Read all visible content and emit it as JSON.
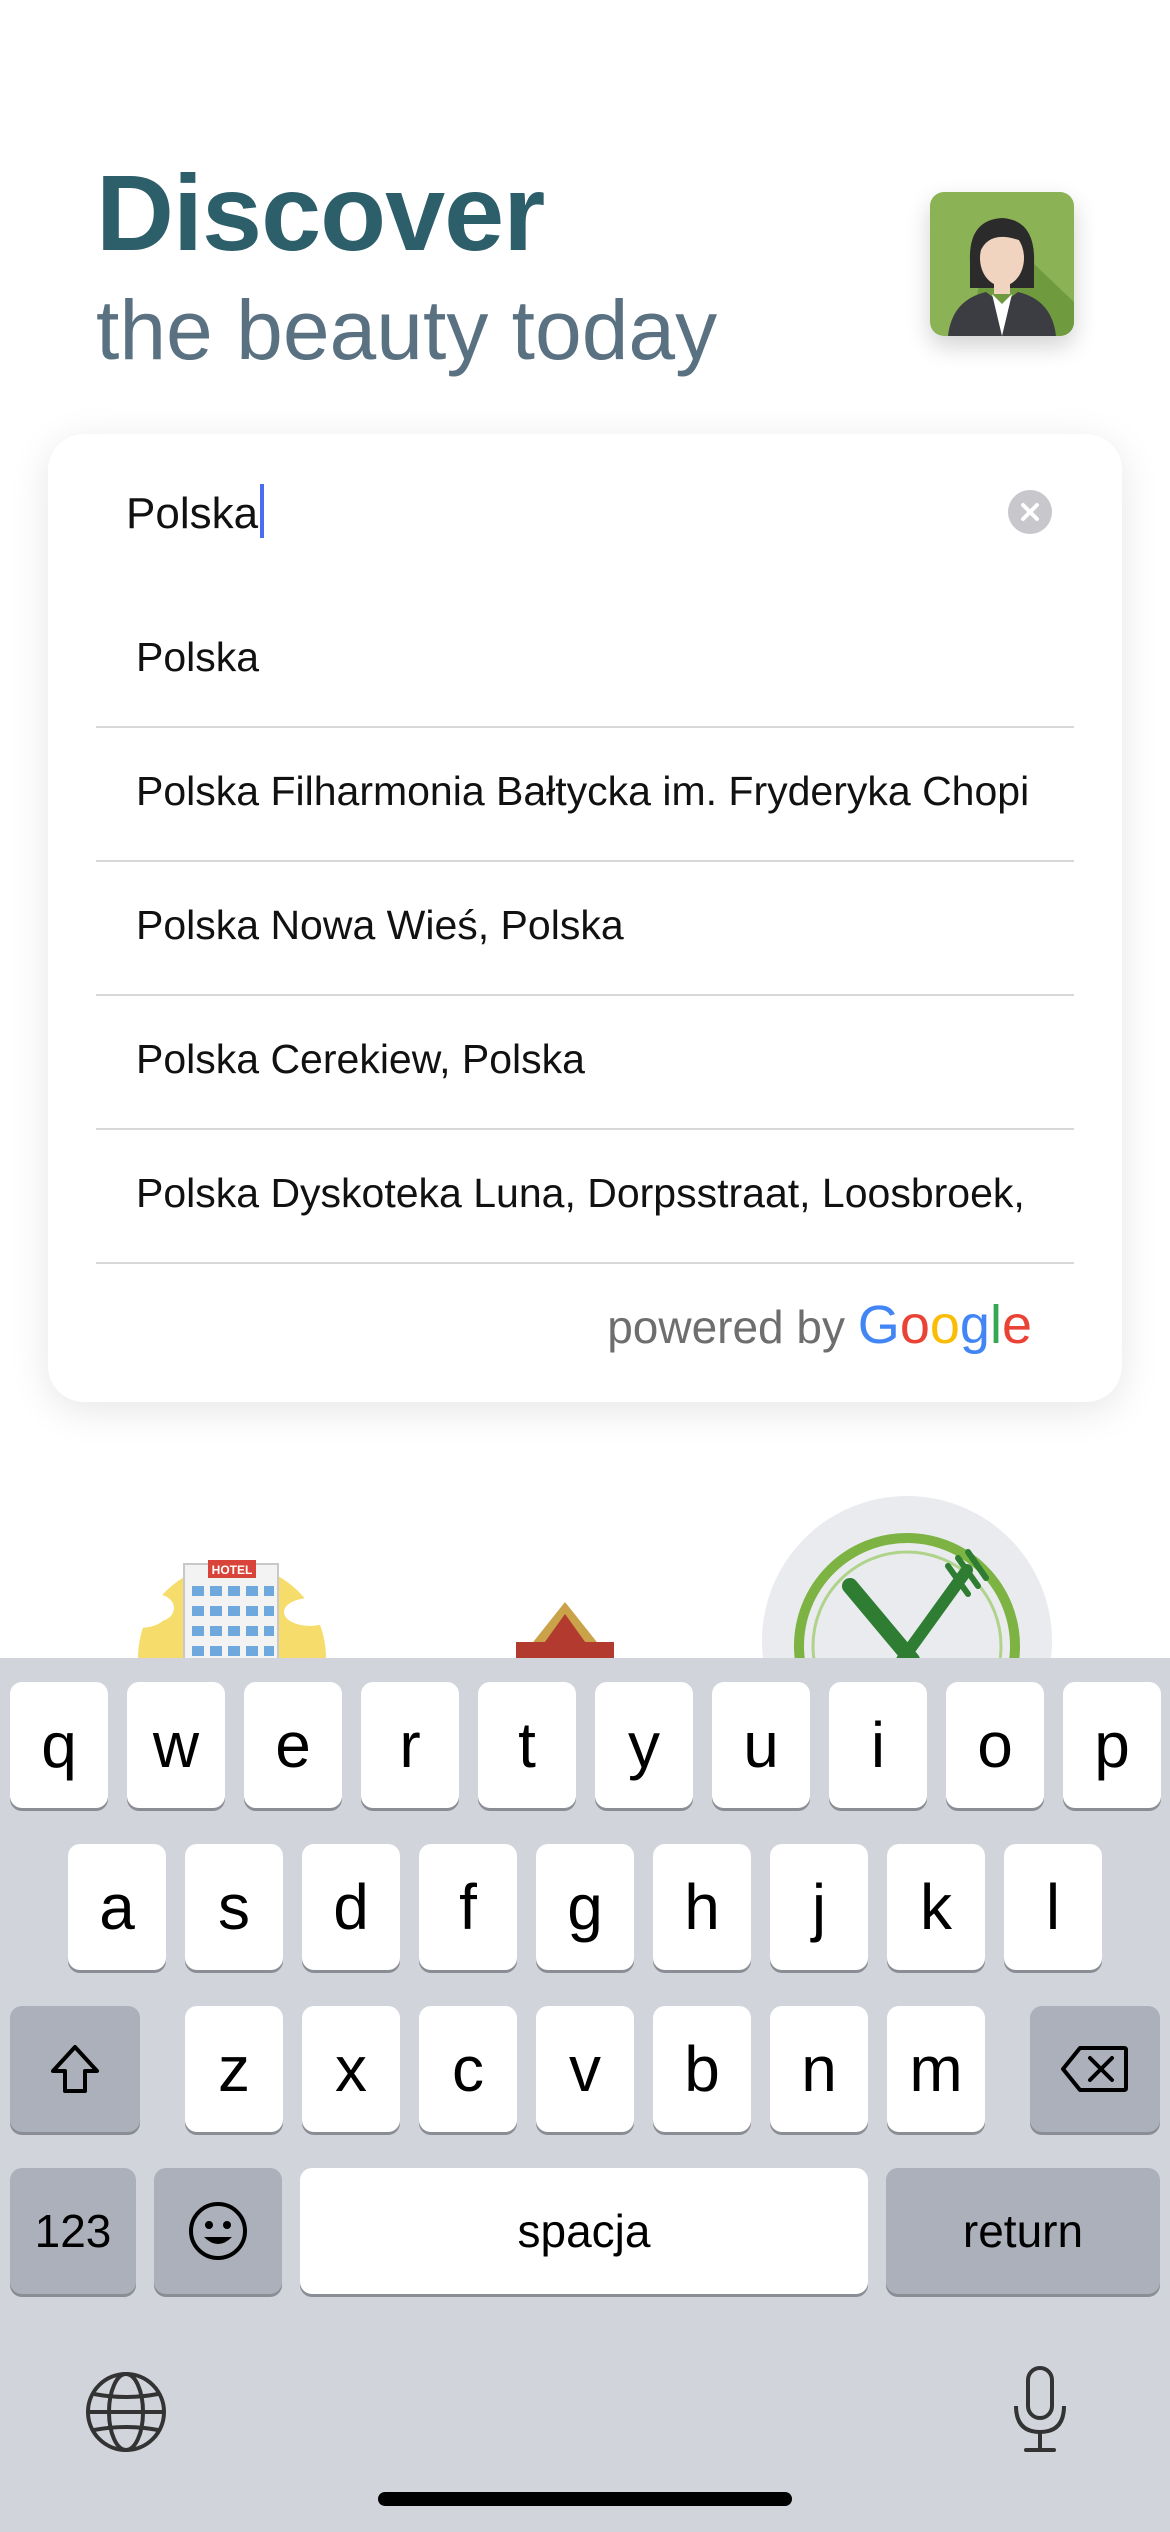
{
  "header": {
    "title": "Discover",
    "subtitle": "the beauty today"
  },
  "search": {
    "value": "Polska"
  },
  "suggestions": [
    "Polska",
    "Polska Filharmonia Bałtycka im. Fryderyka Chopi",
    "Polska Nowa Wieś, Polska",
    "Polska Cerekiew, Polska",
    "Polska Dyskoteka Luna, Dorpsstraat, Loosbroek,"
  ],
  "attribution": {
    "prefix": "powered by",
    "brand": [
      "G",
      "o",
      "o",
      "g",
      "l",
      "e"
    ],
    "brand_colors": [
      "#4285F4",
      "#EA4335",
      "#FBBC05",
      "#4285F4",
      "#34A853",
      "#EA4335"
    ]
  },
  "categories": {
    "hotel_sign": "HOTEL"
  },
  "keyboard": {
    "row1": [
      "q",
      "w",
      "e",
      "r",
      "t",
      "y",
      "u",
      "i",
      "o",
      "p"
    ],
    "row2": [
      "a",
      "s",
      "d",
      "f",
      "g",
      "h",
      "j",
      "k",
      "l"
    ],
    "row3": [
      "z",
      "x",
      "c",
      "v",
      "b",
      "n",
      "m"
    ],
    "numbers_label": "123",
    "space_label": "spacja",
    "return_label": "return"
  },
  "colors": {
    "title": "#2d5f6b",
    "subtitle": "#5a7182",
    "caret": "#4a6cf0",
    "keyboard_bg": "#d1d4db"
  }
}
